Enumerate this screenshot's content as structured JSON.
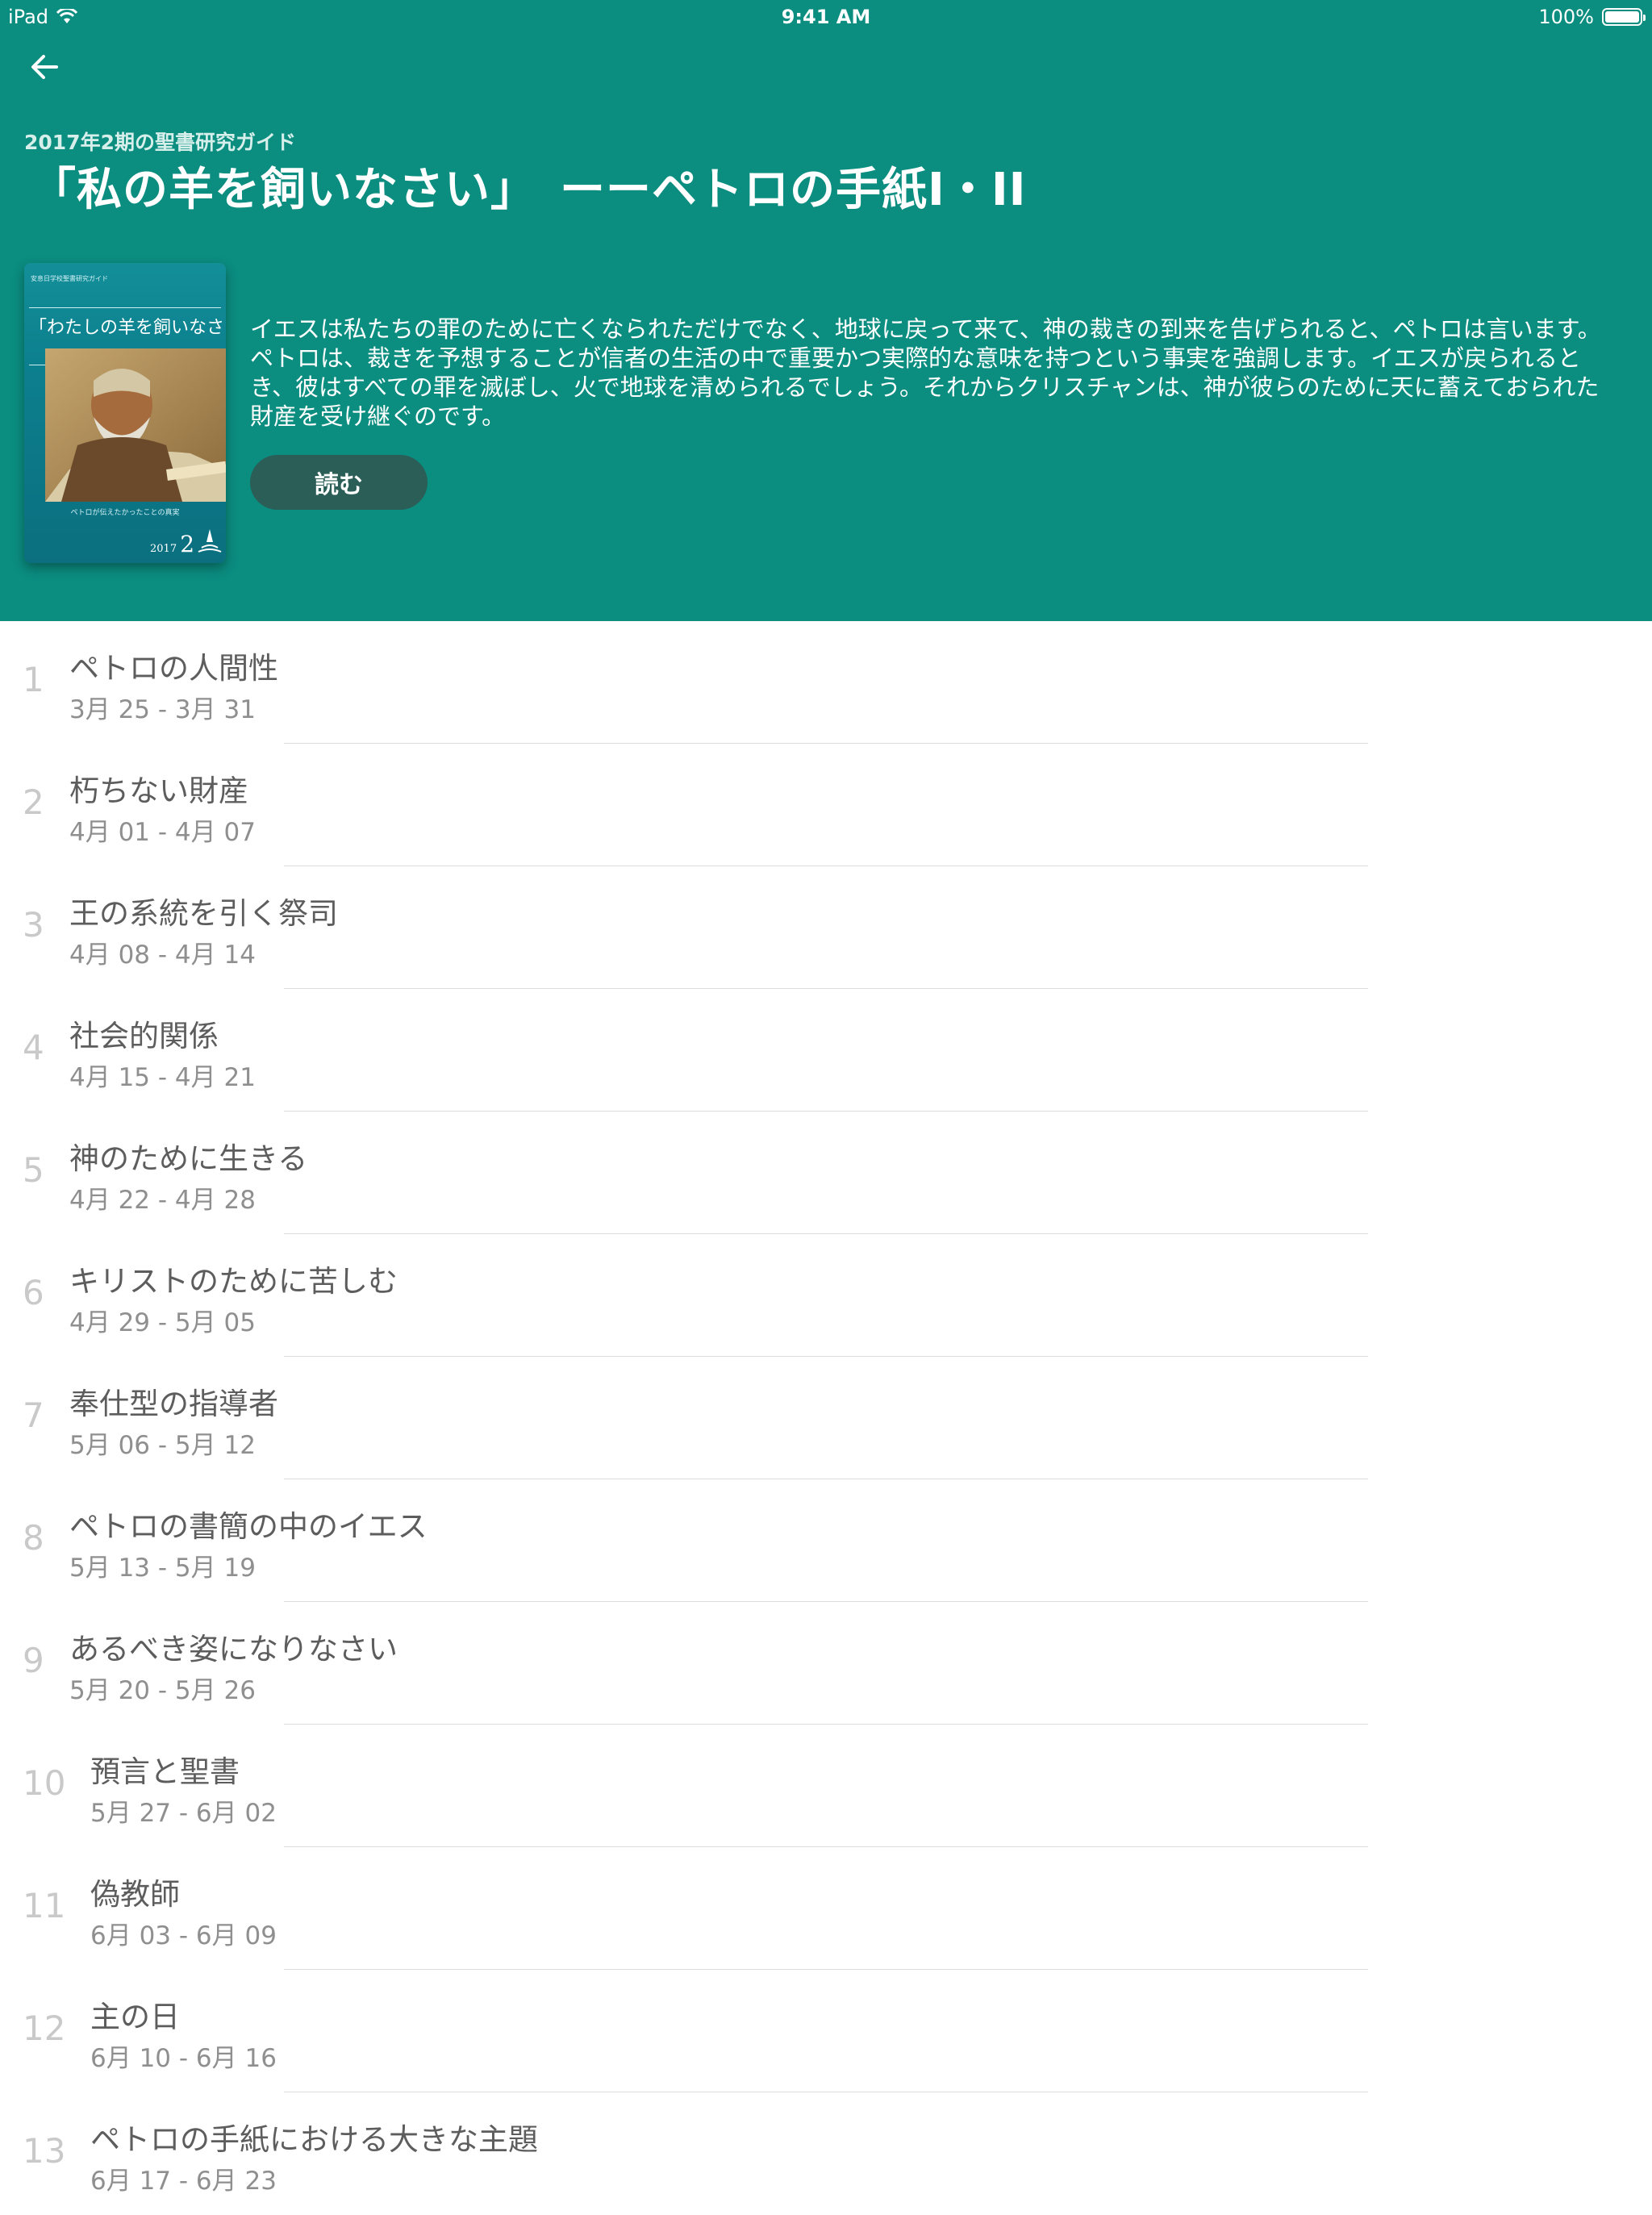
{
  "status_bar": {
    "device": "iPad",
    "time": "9:41 AM",
    "battery": "100%"
  },
  "header": {
    "subtitle": "2017年2期の聖書研究ガイド",
    "title": "「私の羊を飼いなさい」　ーーペトロの手紙I・II",
    "description": "イエスは私たちの罪のために亡くなられただけでなく、地球に戻って来て、神の裁きの到来を告げられると、ペトロは言います。ペトロは、裁きを予想することが信者の生活の中で重要かつ実際的な意味を持つという事実を強調します。イエスが戻られるとき、彼はすべての罪を滅ぼし、火で地球を清められるでしょう。それからクリスチャンは、神が彼らのために天に蓄えておられた財産を受け継ぐのです。",
    "read_button": "読む"
  },
  "cover": {
    "top_text": "安息日学校聖書研究ガイド",
    "title": "「わたしの羊を飼いなさい」",
    "subtitle": "ーーペトロの手紙 I・II",
    "bottom_text": "ペトロが伝えたかったことの真実",
    "year": "2017",
    "quarter": "2"
  },
  "lessons": [
    {
      "num": "1",
      "title": "ペトロの人間性",
      "date": "3月 25 - 3月 31"
    },
    {
      "num": "2",
      "title": "朽ちない財産",
      "date": "4月 01 - 4月 07"
    },
    {
      "num": "3",
      "title": "王の系統を引く祭司",
      "date": "4月 08 - 4月 14"
    },
    {
      "num": "4",
      "title": "社会的関係",
      "date": "4月 15 - 4月 21"
    },
    {
      "num": "5",
      "title": "神のために生きる",
      "date": "4月 22 - 4月 28"
    },
    {
      "num": "6",
      "title": "キリストのために苦しむ",
      "date": "4月 29 - 5月 05"
    },
    {
      "num": "7",
      "title": "奉仕型の指導者",
      "date": "5月 06 - 5月 12"
    },
    {
      "num": "8",
      "title": "ペトロの書簡の中のイエス",
      "date": "5月 13 - 5月 19"
    },
    {
      "num": "9",
      "title": "あるべき姿になりなさい",
      "date": "5月 20 - 5月 26"
    },
    {
      "num": "10",
      "title": "預言と聖書",
      "date": "5月 27 - 6月 02"
    },
    {
      "num": "11",
      "title": "偽教師",
      "date": "6月 03 - 6月 09"
    },
    {
      "num": "12",
      "title": "主の日",
      "date": "6月 10 - 6月 16"
    },
    {
      "num": "13",
      "title": "ペトロの手紙における大きな主題",
      "date": "6月 17 - 6月 23"
    }
  ]
}
